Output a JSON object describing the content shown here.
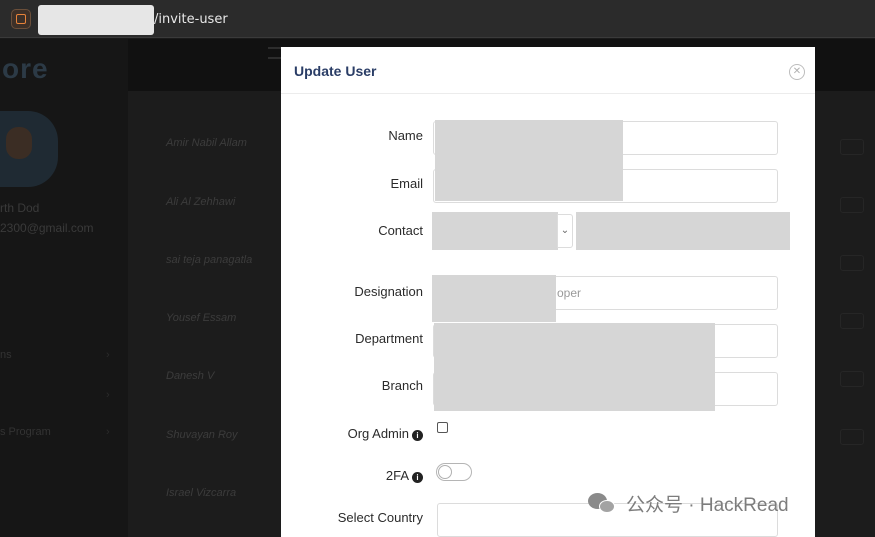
{
  "browser": {
    "url_path": "/invite-user"
  },
  "background": {
    "user_name": "rth Dod",
    "user_email": "2300@gmail.com",
    "menu_items": [
      "ns",
      "s Program"
    ],
    "rows": [
      "Amir Nabil Allam",
      "Ali Al Zehhawi",
      "sai teja panagatla",
      "Yousef Essam",
      "Danesh V",
      "Shuvayan Roy",
      "Israel Vizcarra"
    ]
  },
  "modal": {
    "title": "Update User",
    "close_icon": "close-icon",
    "fields": {
      "name_label": "Name",
      "email_label": "Email",
      "contact_label": "Contact",
      "designation_label": "Designation",
      "designation_value_partial": "oper",
      "department_label": "Department",
      "branch_label": "Branch",
      "org_admin_label": "Org Admin",
      "twofa_label": "2FA",
      "country_label": "Select Country"
    },
    "org_admin_checked": false,
    "twofa_enabled": false
  },
  "watermark": {
    "text": "公众号 · HackRead"
  }
}
